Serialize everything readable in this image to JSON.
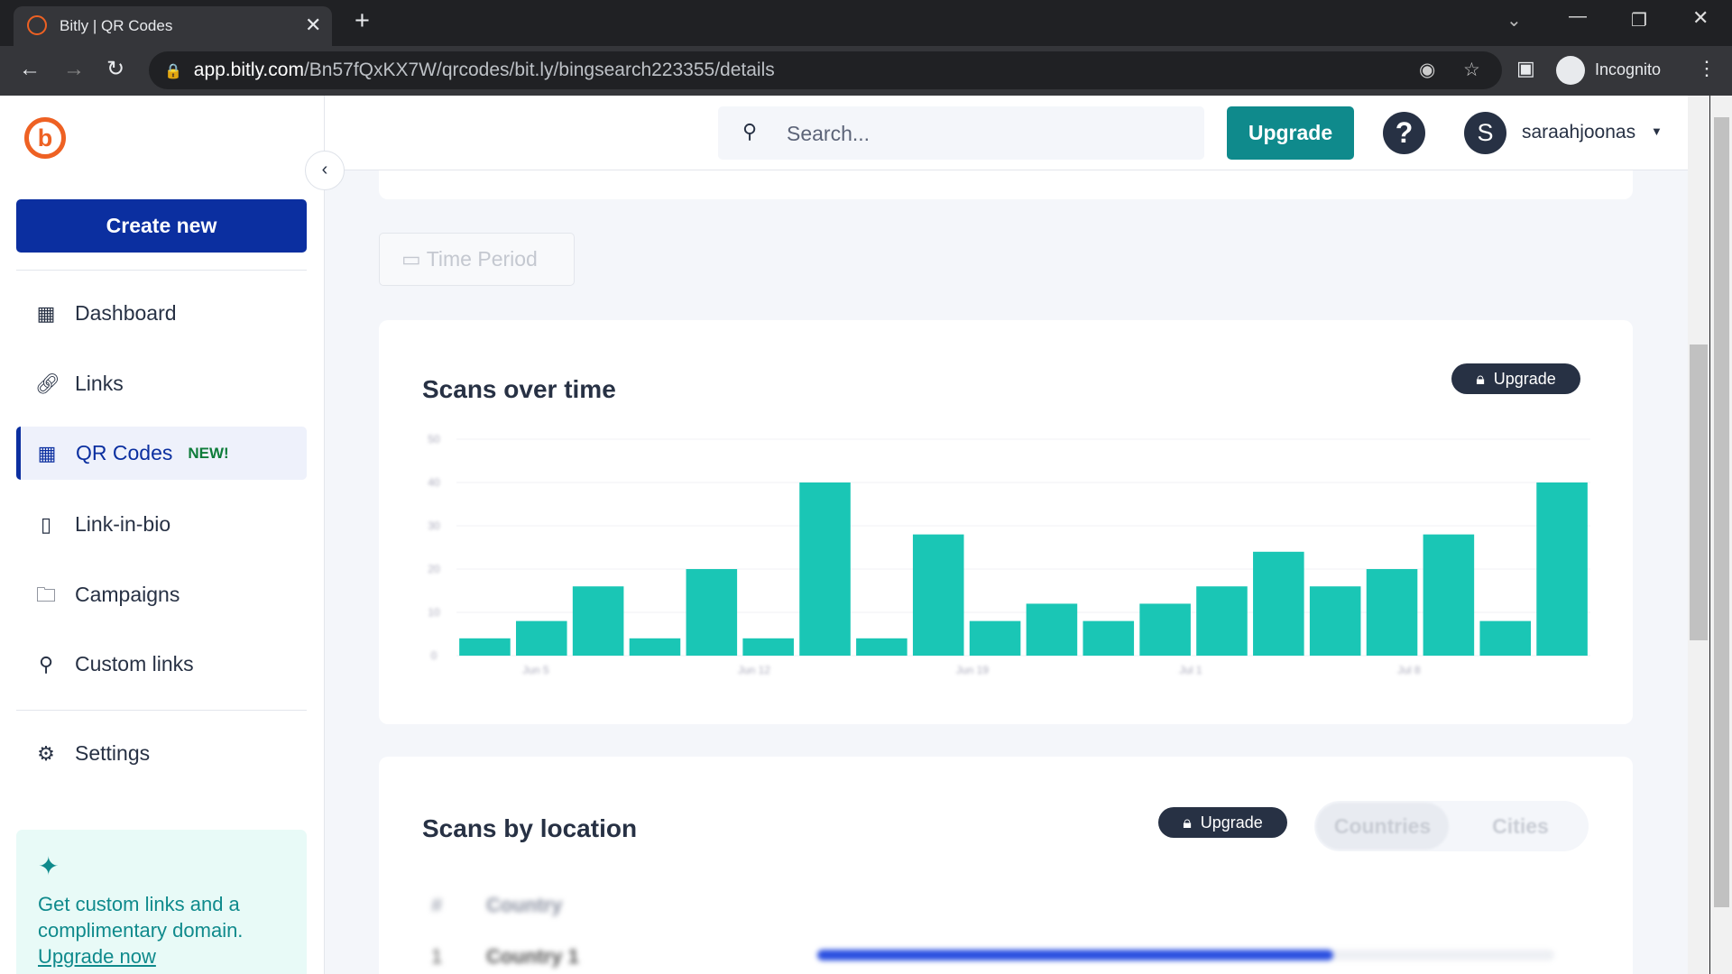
{
  "browser": {
    "tab_title": "Bitly | QR Codes",
    "url_host": "app.bitly.com",
    "url_path": "/Bn57fQxKX7W/qrcodes/bit.ly/bingsearch223355/details",
    "profile": "Incognito"
  },
  "header": {
    "search_placeholder": "Search...",
    "upgrade_label": "Upgrade",
    "help": "?",
    "avatar_initial": "S",
    "username": "saraahjoonas"
  },
  "sidebar": {
    "create_label": "Create new",
    "items": [
      {
        "label": "Dashboard",
        "icon": "grid-icon"
      },
      {
        "label": "Links",
        "icon": "link-icon"
      },
      {
        "label": "QR Codes",
        "icon": "qr-icon",
        "badge": "NEW!",
        "active": true
      },
      {
        "label": "Link-in-bio",
        "icon": "page-icon"
      },
      {
        "label": "Campaigns",
        "icon": "folder-star-icon"
      },
      {
        "label": "Custom links",
        "icon": "custom-link-icon"
      },
      {
        "label": "Settings",
        "icon": "gear-icon"
      }
    ],
    "promo": {
      "text": "Get custom links and a complimentary domain.",
      "link": "Upgrade now"
    }
  },
  "main": {
    "time_period": "Time Period",
    "scans_over_time": {
      "title": "Scans over time",
      "upgrade": "Upgrade"
    },
    "scans_by_location": {
      "title": "Scans by location",
      "upgrade": "Upgrade",
      "tabs": [
        "Countries",
        "Cities"
      ],
      "table_headers": [
        "#",
        "Country"
      ],
      "rows": [
        {
          "rank": "1",
          "name": "Country 1",
          "share": 0.7
        }
      ]
    }
  },
  "colors": {
    "accent": "#0f8a8c",
    "bar": "#1ac6b5",
    "brand": "#ee6123",
    "primary": "#0b2fa0"
  },
  "chart_data": {
    "type": "bar",
    "title": "Scans over time",
    "yticks": [
      "0",
      "10",
      "20",
      "30",
      "40",
      "50"
    ],
    "xticks": [
      "Jun 5",
      "Jun 12",
      "Jun 19",
      "Jul 1",
      "Jul 8"
    ],
    "ylim": [
      0,
      50
    ],
    "grid": true,
    "values": [
      4,
      8,
      16,
      4,
      20,
      4,
      40,
      4,
      28,
      8,
      12,
      8,
      12,
      16,
      24,
      16,
      20,
      28,
      8,
      40
    ]
  }
}
